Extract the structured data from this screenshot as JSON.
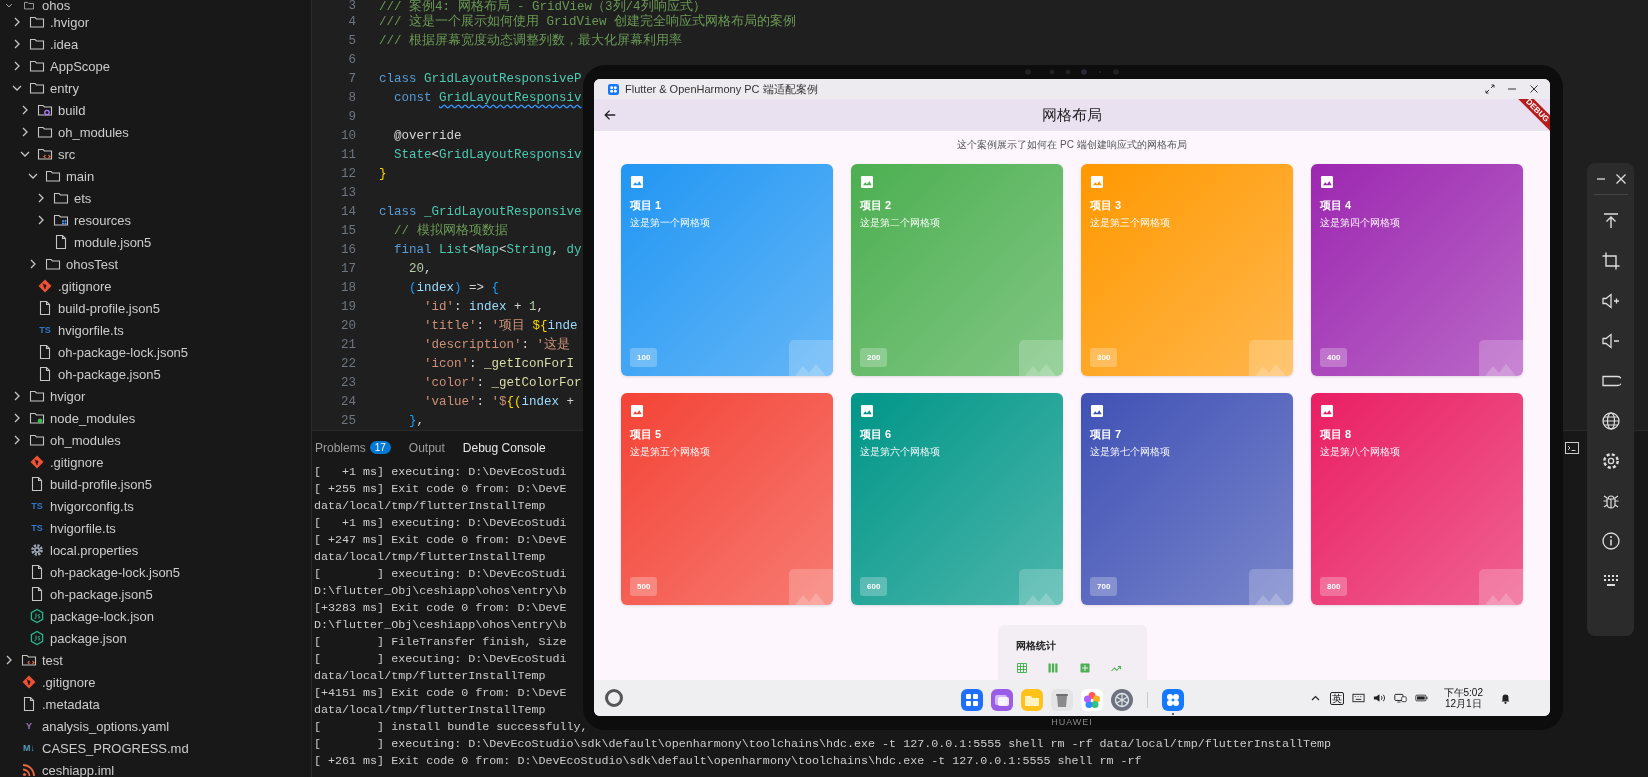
{
  "explorer": {
    "items": [
      {
        "name": "ohos",
        "kind": "folder",
        "expanded": true,
        "children": [
          {
            "name": ".hvigor",
            "kind": "folder",
            "expanded": false
          },
          {
            "name": ".idea",
            "kind": "folder",
            "expanded": false
          },
          {
            "name": "AppScope",
            "kind": "folder",
            "expanded": false
          },
          {
            "name": "entry",
            "kind": "folder",
            "expanded": true,
            "children": [
              {
                "name": "build",
                "kind": "build-folder",
                "expanded": false
              },
              {
                "name": "oh_modules",
                "kind": "folder",
                "expanded": false
              },
              {
                "name": "src",
                "kind": "source-folder",
                "expanded": true,
                "children": [
                  {
                    "name": "main",
                    "kind": "folder",
                    "expanded": true,
                    "children": [
                      {
                        "name": "ets",
                        "kind": "folder",
                        "expanded": false
                      },
                      {
                        "name": "resources",
                        "kind": "resource-folder",
                        "expanded": false
                      },
                      {
                        "name": "module.json5",
                        "kind": "file"
                      }
                    ]
                  },
                  {
                    "name": "ohosTest",
                    "kind": "folder",
                    "expanded": false
                  }
                ]
              },
              {
                "name": ".gitignore",
                "kind": "git"
              },
              {
                "name": "build-profile.json5",
                "kind": "file"
              },
              {
                "name": "hvigorfile.ts",
                "kind": "ts",
                "icon_text": "TS"
              },
              {
                "name": "oh-package-lock.json5",
                "kind": "file"
              },
              {
                "name": "oh-package.json5",
                "kind": "file"
              }
            ]
          },
          {
            "name": "hvigor",
            "kind": "folder",
            "expanded": false
          },
          {
            "name": "node_modules",
            "kind": "node-folder",
            "expanded": false
          },
          {
            "name": "oh_modules",
            "kind": "folder",
            "expanded": false
          },
          {
            "name": ".gitignore",
            "kind": "git"
          },
          {
            "name": "build-profile.json5",
            "kind": "file"
          },
          {
            "name": "hvigorconfig.ts",
            "kind": "ts",
            "icon_text": "TS"
          },
          {
            "name": "hvigorfile.ts",
            "kind": "ts",
            "icon_text": "TS"
          },
          {
            "name": "local.properties",
            "kind": "config"
          },
          {
            "name": "oh-package-lock.json5",
            "kind": "file"
          },
          {
            "name": "oh-package.json5",
            "kind": "file"
          },
          {
            "name": "package-lock.json",
            "kind": "json"
          },
          {
            "name": "package.json",
            "kind": "json"
          }
        ]
      },
      {
        "name": "test",
        "kind": "source-folder",
        "expanded": false
      },
      {
        "name": ".gitignore",
        "kind": "git"
      },
      {
        "name": ".metadata",
        "kind": "file"
      },
      {
        "name": "analysis_options.yaml",
        "kind": "yaml",
        "icon_text": "Y"
      },
      {
        "name": "CASES_PROGRESS.md",
        "kind": "markdown",
        "icon_text": "M↓"
      },
      {
        "name": "ceshiapp.iml",
        "kind": "feed"
      }
    ]
  },
  "editor": {
    "lines": [
      {
        "number": "3",
        "tokens": [
          {
            "text": "/// 案例4: 网格布局 - GridView（3列/4列响应式）",
            "kind": "comment"
          }
        ]
      },
      {
        "number": "4",
        "tokens": [
          {
            "text": "/// 这是一个展示如何使用 GridView 创建完全响应式网格布局的案例",
            "kind": "comment"
          }
        ]
      },
      {
        "number": "5",
        "tokens": [
          {
            "text": "/// 根据屏幕宽度动态调整列数，最大化屏幕利用率",
            "kind": "comment"
          }
        ]
      },
      {
        "number": "6"
      },
      {
        "number": "7",
        "tokens": [
          {
            "text": "class",
            "kind": "keyword"
          },
          {
            "text": " GridLayoutResponsiveP",
            "kind": "type"
          }
        ]
      },
      {
        "number": "8",
        "tokens": [
          {
            "text": "  const ",
            "kind": "keyword"
          },
          {
            "text": "GridLayoutResponsiv",
            "kind": "warned-type"
          }
        ]
      },
      {
        "number": "9"
      },
      {
        "number": "10",
        "tokens": [
          {
            "text": "  @override",
            "kind": "plain"
          }
        ]
      },
      {
        "number": "11",
        "tokens": [
          {
            "text": "  State",
            "kind": "type"
          },
          {
            "text": "<",
            "kind": "plain"
          },
          {
            "text": "GridLayoutResponsiv",
            "kind": "type"
          }
        ]
      },
      {
        "number": "12",
        "tokens": [
          {
            "text": "}",
            "kind": "bracket"
          }
        ]
      },
      {
        "number": "13"
      },
      {
        "number": "14",
        "tokens": [
          {
            "text": "class",
            "kind": "keyword"
          },
          {
            "text": " _GridLayoutResponsive",
            "kind": "type"
          }
        ]
      },
      {
        "number": "15",
        "tokens": [
          {
            "text": "  // 模拟网格项数据",
            "kind": "comment"
          }
        ]
      },
      {
        "number": "16",
        "tokens": [
          {
            "text": "  final",
            "kind": "keyword"
          },
          {
            "text": " List",
            "kind": "type"
          },
          {
            "text": "<",
            "kind": "plain"
          },
          {
            "text": "Map",
            "kind": "type"
          },
          {
            "text": "<",
            "kind": "plain"
          },
          {
            "text": "String",
            "kind": "type"
          },
          {
            "text": ",",
            "kind": "plain"
          },
          {
            "text": " dy",
            "kind": "type"
          }
        ]
      },
      {
        "number": "17",
        "tokens": [
          {
            "text": "    20",
            "kind": "number"
          },
          {
            "text": ",",
            "kind": "plain"
          }
        ]
      },
      {
        "number": "18",
        "tokens": [
          {
            "text": "    (",
            "kind": "bracket2"
          },
          {
            "text": "index",
            "kind": "variable"
          },
          {
            "text": ")",
            "kind": "bracket2"
          },
          {
            "text": " =>",
            "kind": "plain"
          },
          {
            "text": " {",
            "kind": "bracket2"
          }
        ]
      },
      {
        "number": "19",
        "tokens": [
          {
            "text": "      'id'",
            "kind": "string"
          },
          {
            "text": ":",
            "kind": "plain"
          },
          {
            "text": " index",
            "kind": "variable"
          },
          {
            "text": " + ",
            "kind": "plain"
          },
          {
            "text": "1",
            "kind": "number"
          },
          {
            "text": ",",
            "kind": "plain"
          }
        ]
      },
      {
        "number": "20",
        "tokens": [
          {
            "text": "      'title'",
            "kind": "string"
          },
          {
            "text": ":",
            "kind": "plain"
          },
          {
            "text": " '项目 ",
            "kind": "string"
          },
          {
            "text": "${",
            "kind": "bracket"
          },
          {
            "text": "inde",
            "kind": "variable"
          }
        ]
      },
      {
        "number": "21",
        "tokens": [
          {
            "text": "      'description'",
            "kind": "string"
          },
          {
            "text": ":",
            "kind": "plain"
          },
          {
            "text": " '这是",
            "kind": "string"
          }
        ]
      },
      {
        "number": "22",
        "tokens": [
          {
            "text": "      'icon'",
            "kind": "string"
          },
          {
            "text": ":",
            "kind": "plain"
          },
          {
            "text": " _getIconForI",
            "kind": "function"
          }
        ]
      },
      {
        "number": "23",
        "tokens": [
          {
            "text": "      'color'",
            "kind": "string"
          },
          {
            "text": ":",
            "kind": "plain"
          },
          {
            "text": " _getColorFor",
            "kind": "function"
          }
        ]
      },
      {
        "number": "24",
        "tokens": [
          {
            "text": "      'value'",
            "kind": "string"
          },
          {
            "text": ":",
            "kind": "plain"
          },
          {
            "text": " '$",
            "kind": "string"
          },
          {
            "text": "{(",
            "kind": "bracket"
          },
          {
            "text": "index",
            "kind": "variable"
          },
          {
            "text": " +",
            "kind": "plain"
          }
        ]
      },
      {
        "number": "25",
        "tokens": [
          {
            "text": "    }",
            "kind": "bracket2"
          },
          {
            "text": ",",
            "kind": "plain"
          }
        ]
      }
    ]
  },
  "panel": {
    "tabs": [
      {
        "label": "Problems",
        "badge": "17",
        "selected": false
      },
      {
        "label": "Output",
        "selected": false
      },
      {
        "label": "Debug Console",
        "selected": true
      }
    ],
    "terminal_lines": [
      "[   +1 ms] executing: D:\\DevEcoStudi",
      "[ +255 ms] Exit code 0 from: D:\\DevE",
      "data/local/tmp/flutterInstallTemp",
      "[   +1 ms] executing: D:\\DevEcoStudi",
      "[ +247 ms] Exit code 0 from: D:\\DevE",
      "data/local/tmp/flutterInstallTemp",
      "[        ] executing: D:\\DevEcoStudi",
      "D:\\flutter_Obj\\ceshiapp\\ohos\\entry\\b",
      "[+3283 ms] Exit code 0 from: D:\\DevE",
      "D:\\flutter_Obj\\ceshiapp\\ohos\\entry\\b",
      "[        ] FileTransfer finish, Size",
      "[        ] executing: D:\\DevEcoStudi",
      "data/local/tmp/flutterInstallTemp",
      "[+4151 ms] Exit code 0 from: D:\\DevE",
      "data/local/tmp/flutterInstallTemp",
      "[        ] install bundle successfully,",
      "[        ] executing: D:\\DevEcoStudio\\sdk\\default\\openharmony\\toolchains\\hdc.exe -t 127.0.0.1:5555 shell rm -rf data/local/tmp/flutterInstallTemp",
      "[ +261 ms] Exit code 0 from: D:\\DevEcoStudio\\sdk\\default\\openharmony\\toolchains\\hdc.exe -t 127.0.0.1:5555 shell rm -rf"
    ]
  },
  "device": {
    "brand": "HUAWEI",
    "window": {
      "title": "Flutter & OpenHarmony PC 端适配案例"
    },
    "app_bar": {
      "title": "网格布局",
      "debug_banner": "DEBUG"
    },
    "subtitle": "这个案例展示了如何在 PC 端创建响应式的网格布局",
    "cards": [
      {
        "title": "项目 1",
        "description": "这是第一个网格项",
        "value": "100",
        "color": "#2196f3"
      },
      {
        "title": "项目 2",
        "description": "这是第二个网格项",
        "value": "200",
        "color": "#4caf50"
      },
      {
        "title": "项目 3",
        "description": "这是第三个网格项",
        "value": "300",
        "color": "#ff9800"
      },
      {
        "title": "项目 4",
        "description": "这是第四个网格项",
        "value": "400",
        "color": "#9c27b0"
      },
      {
        "title": "项目 5",
        "description": "这是第五个网格项",
        "value": "500",
        "color": "#f44336"
      },
      {
        "title": "项目 6",
        "description": "这是第六个网格项",
        "value": "600",
        "color": "#009688"
      },
      {
        "title": "项目 7",
        "description": "这是第七个网格项",
        "value": "700",
        "color": "#3f51b5"
      },
      {
        "title": "项目 8",
        "description": "这是第八个网格项",
        "value": "800",
        "color": "#e91e63"
      }
    ],
    "stats": {
      "title": "网格统计"
    },
    "taskbar": {
      "input_method": "英",
      "time": "下午5:02",
      "date": "12月1日"
    }
  }
}
